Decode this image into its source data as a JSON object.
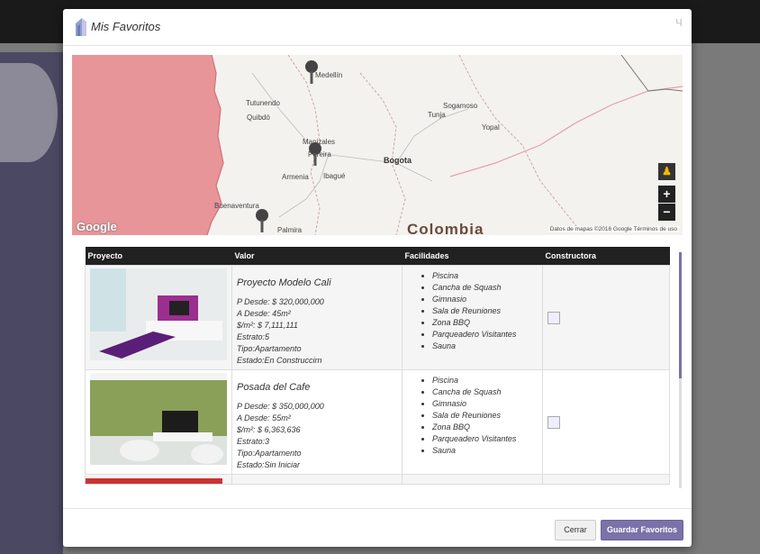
{
  "modal": {
    "title": "Mis Favoritos",
    "close_glyph": "ч"
  },
  "map": {
    "provider_logo": "Google",
    "attribution": "Datos de mapas ©2016 Google   Términos de uso",
    "country_label": "Colombia",
    "cities": [
      "Medellín",
      "Tutunendo",
      "Quibdó",
      "Manizales",
      "Pereira",
      "Armenia",
      "Ibagué",
      "Bogota",
      "Tunja",
      "Sogamoso",
      "Yopal",
      "Buenaventura",
      "Palmira"
    ],
    "controls": {
      "pegman": "pegman-icon",
      "zoom_in": "+",
      "zoom_out": "−"
    }
  },
  "table": {
    "headers": {
      "proyecto": "Proyecto",
      "valor": "Valor",
      "facilidades": "Facilidades",
      "constructora": "Constructora"
    },
    "rows": [
      {
        "name": "Proyecto Modelo Cali",
        "precio": "P Desde: $ 320,000,000",
        "area": "A Desde: 45m²",
        "precio_m2": "$/m²: $ 7,111,111",
        "estrato": "Estrato:5",
        "tipo": "Tipo:Apartamento",
        "estado": "Estado:En Construccirn",
        "facilidades": [
          "Piscina",
          "Cancha de Squash",
          "Gimnasio",
          "Sala de Reuniones",
          "Zona BBQ",
          "Parqueadero Visitantes",
          "Sauna"
        ]
      },
      {
        "name": "Posada del Cafe",
        "precio": "P Desde: $ 350,000,000",
        "area": "A Desde: 55m²",
        "precio_m2": "$/m²: $ 6,363,636",
        "estrato": "Estrato:3",
        "tipo": "Tipo:Apartamento",
        "estado": "Estado:Sin Iniciar",
        "facilidades": [
          "Piscina",
          "Cancha de Squash",
          "Gimnasio",
          "Sala de Reuniones",
          "Zona BBQ",
          "Parqueadero Visitantes",
          "Sauna"
        ]
      }
    ]
  },
  "footer": {
    "cancel_label": "Cerrar",
    "save_label": "Guardar Favoritos"
  },
  "colors": {
    "accent": "#7b72a9",
    "header_dark": "#212121",
    "ocean_pink": "#e8959a"
  }
}
